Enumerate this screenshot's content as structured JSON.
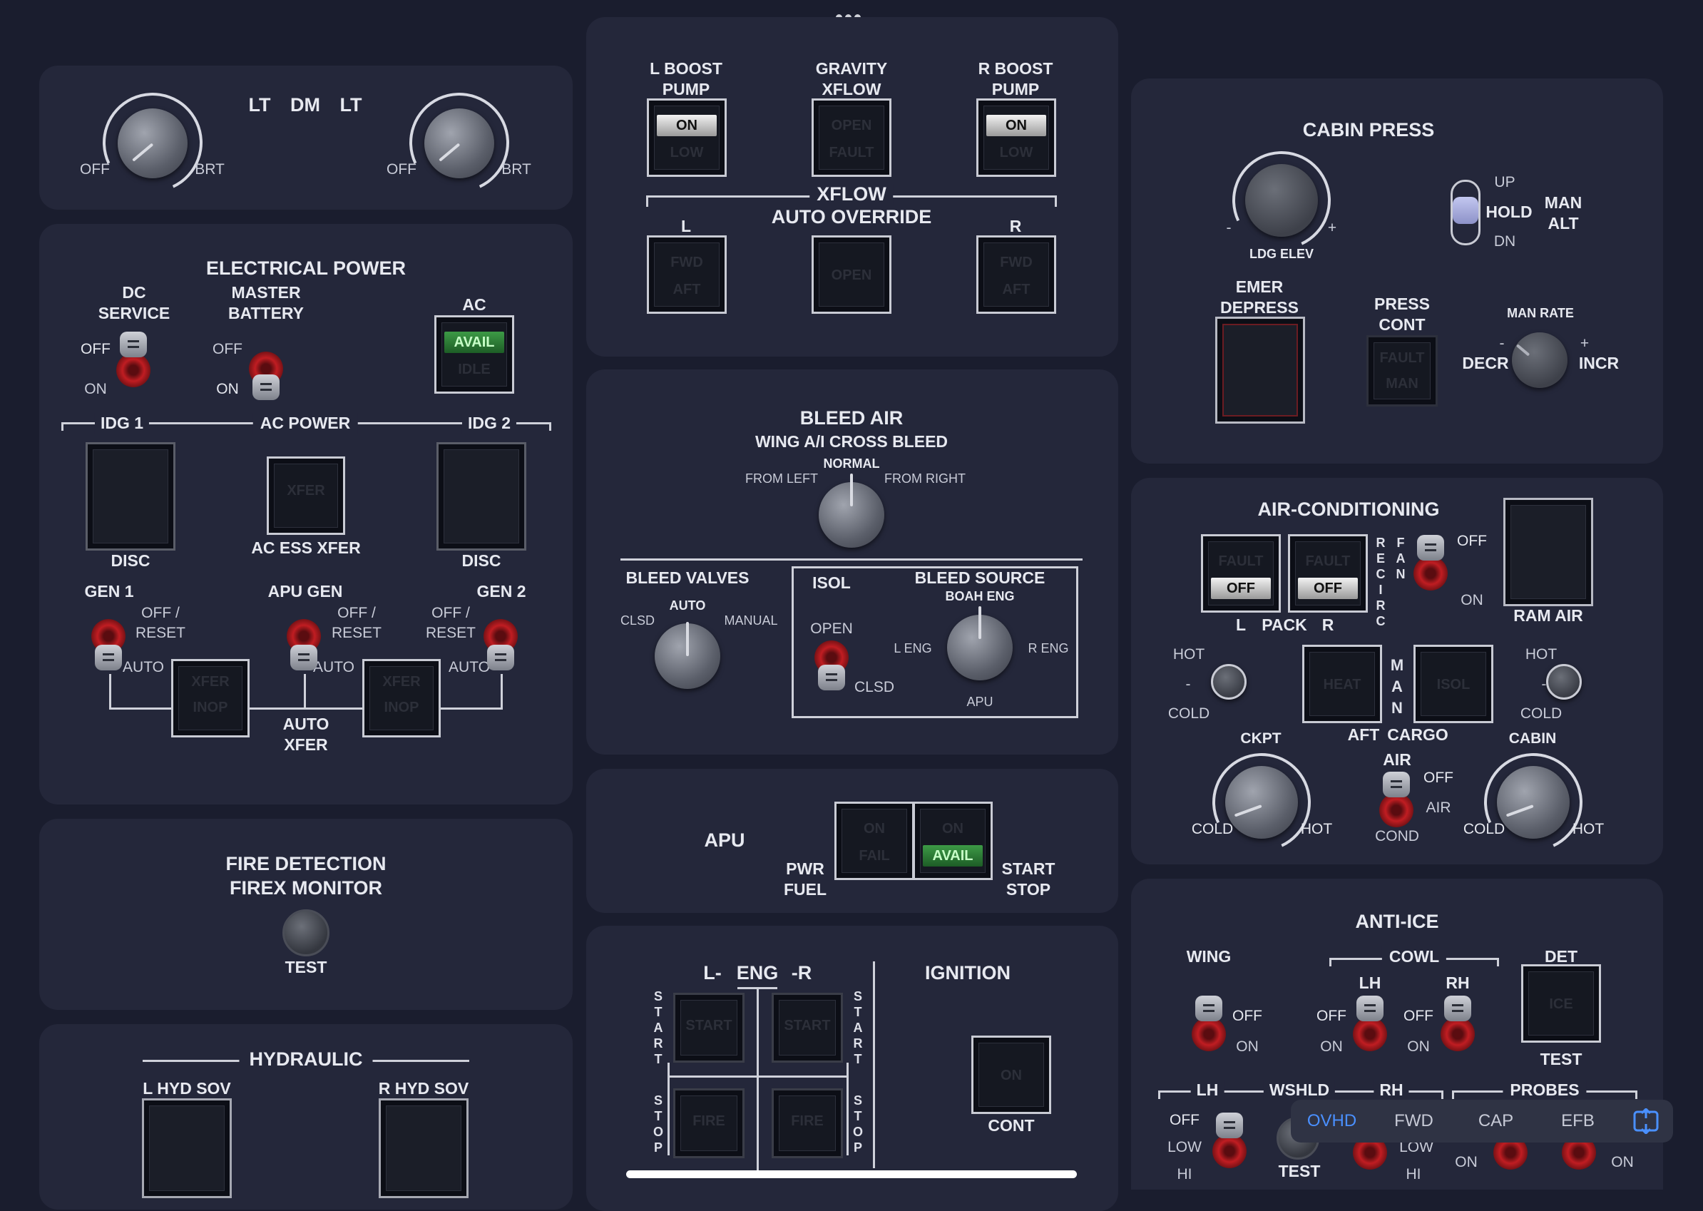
{
  "lighting": {
    "lt_left": "LT",
    "dm": "DM",
    "lt_right": "LT",
    "off": "OFF",
    "brt": "BRT"
  },
  "electrical": {
    "title": "ELECTRICAL POWER",
    "dc_service": "DC\nSERVICE",
    "master_battery": "MASTER\nBATTERY",
    "ac": "AC",
    "off": "OFF",
    "on": "ON",
    "avail": "AVAIL",
    "idg1": "IDG 1",
    "ac_power": "AC POWER",
    "idg2": "IDG 2",
    "disc": "DISC",
    "ac_ess_xfer": "AC ESS XFER",
    "gen1": "GEN 1",
    "apu_gen": "APU GEN",
    "gen2": "GEN 2",
    "off_reset": "OFF /\nRESET",
    "auto": "AUTO",
    "auto_xfer": "AUTO\nXFER"
  },
  "fire": {
    "title": "FIRE DETECTION\nFIREX MONITOR",
    "test": "TEST"
  },
  "hydraulic": {
    "title": "HYDRAULIC",
    "l_hyd_sov": "L HYD SOV",
    "r_hyd_sov": "R HYD SOV"
  },
  "fuel": {
    "l_boost": "L BOOST\nPUMP",
    "gravity": "GRAVITY\nXFLOW",
    "r_boost": "R BOOST\nPUMP",
    "on": "ON",
    "xflow": "XFLOW",
    "auto_override": "AUTO OVERRIDE",
    "l": "L",
    "r": "R"
  },
  "bleed": {
    "title": "BLEED AIR",
    "subtitle": "WING A/I CROSS BLEED",
    "normal": "NORMAL",
    "from_left": "FROM LEFT",
    "from_right": "FROM RIGHT",
    "valves": "BLEED VALVES",
    "auto": "AUTO",
    "clsd": "CLSD",
    "manual": "MANUAL",
    "isol": "ISOL",
    "open": "OPEN",
    "source": "BLEED SOURCE",
    "boah_eng": "BOAH ENG",
    "l_eng": "L ENG",
    "r_eng": "R ENG",
    "apu": "APU"
  },
  "apu": {
    "title": "APU",
    "pwr_fuel": "PWR\nFUEL",
    "start_stop": "START\nSTOP",
    "avail": "AVAIL"
  },
  "ignition": {
    "title": "IGNITION",
    "l": "L-",
    "eng": "ENG",
    "r": "-R",
    "start": "S\nT\nA\nR\nT",
    "stop": "S\nT\nO\nP",
    "cont": "CONT"
  },
  "cabin_press": {
    "title": "CABIN PRESS",
    "ldg_elev": "LDG ELEV",
    "minus": "-",
    "plus": "+",
    "up": "UP",
    "hold": "HOLD",
    "dn": "DN",
    "man_alt": "MAN\nALT",
    "emer_depress": "EMER\nDEPRESS",
    "press_cont": "PRESS\nCONT",
    "man_rate": "MAN RATE",
    "decr": "DECR",
    "incr": "INCR"
  },
  "aircon": {
    "title": "AIR-CONDITIONING",
    "off": "OFF",
    "l": "L",
    "pack": "PACK",
    "r": "R",
    "recirc": "R\nE\nC\nI\nR\nC",
    "fan": "F\nA\nN",
    "on": "ON",
    "ram_air": "RAM AIR",
    "hot": "HOT",
    "cold": "COLD",
    "dash": "-",
    "man": "M\nA\nN",
    "aft": "AFT",
    "cargo": "CARGO",
    "ckpt": "CKPT",
    "cabin": "CABIN",
    "air": "AIR",
    "air_cond": "AIR\nCOND"
  },
  "anti_ice": {
    "title": "ANTI-ICE",
    "wing": "WING",
    "cowl": "COWL",
    "lh": "LH",
    "rh": "RH",
    "det": "DET",
    "off": "OFF",
    "on": "ON",
    "test": "TEST",
    "wshld": "WSHLD",
    "probes": "PROBES",
    "low": "LOW",
    "hi": "HI"
  },
  "tabs": [
    "OVHD",
    "FWD",
    "CAP",
    "EFB"
  ],
  "active_tab": "OVHD",
  "colors": {
    "background": "#1a1d2e",
    "panel": "#24273a",
    "accent": "#4a90ff",
    "avail_green": "#2f8a3a",
    "guard_red": "#c01d22"
  }
}
